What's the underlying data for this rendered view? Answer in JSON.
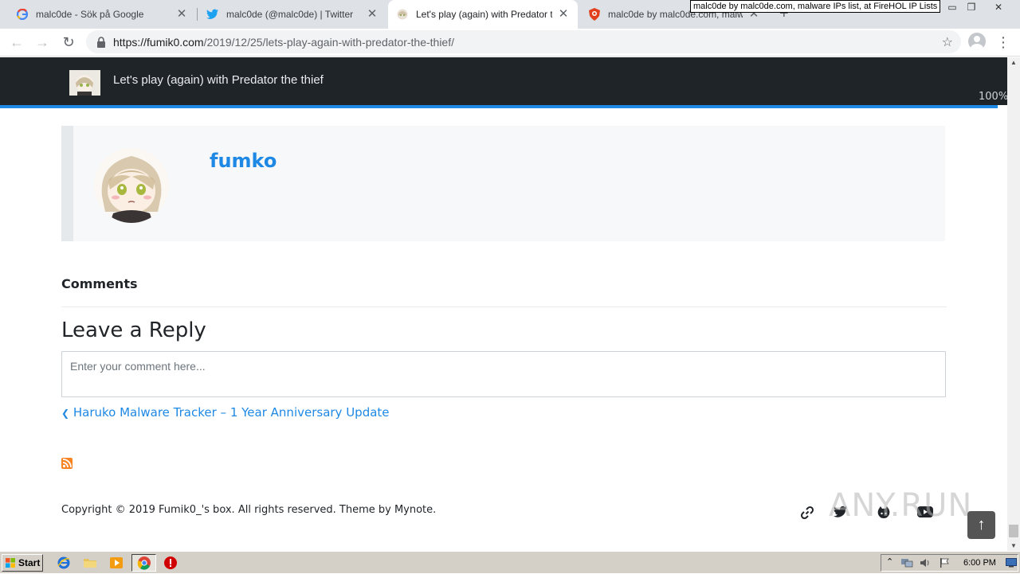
{
  "browser": {
    "tabs": [
      {
        "title": "malc0de - Sök på Google",
        "favicon": "google-icon",
        "active": false
      },
      {
        "title": "malc0de (@malc0de) | Twitter",
        "favicon": "twitter-icon",
        "active": false
      },
      {
        "title": "Let's play (again) with Predator the thief",
        "favicon": "fumik0-icon",
        "active": true
      },
      {
        "title": "malc0de by malc0de.com, malware IPs list, at FireHOL IP Lists",
        "favicon": "firehol-icon",
        "active": false
      }
    ],
    "tooltip": "malc0de by malc0de.com, malware IPs list, at FireHOL IP Lists",
    "url_host": "https://fumik0.com",
    "url_path": "/2019/12/25/lets-play-again-with-predator-the-thief/"
  },
  "page": {
    "header_title": "Let's play (again) with Predator the thief",
    "progress_label": "100%",
    "progress_value": 100,
    "author_name": "fumko",
    "comments_heading": "Comments",
    "reply_heading": "Leave a Reply",
    "comment_placeholder": "Enter your comment here...",
    "prev_post": "Haruko Malware Tracker – 1 Year Anniversary Update",
    "copyright": "Copyright © 2019 Fumik0_'s box. All rights reserved. Theme by Mynote.",
    "social_icons": [
      "link-icon",
      "twitter-icon",
      "github-icon",
      "youtube-icon"
    ],
    "watermark": "ANY.RUN"
  },
  "taskbar": {
    "start_label": "Start",
    "clock": "6:00 PM",
    "apps": [
      "ie-icon",
      "folder-icon",
      "media-player-icon",
      "chrome-icon",
      "stop-icon"
    ]
  },
  "colors": {
    "accent": "#1e88e5",
    "header_bg": "#1f2429"
  }
}
